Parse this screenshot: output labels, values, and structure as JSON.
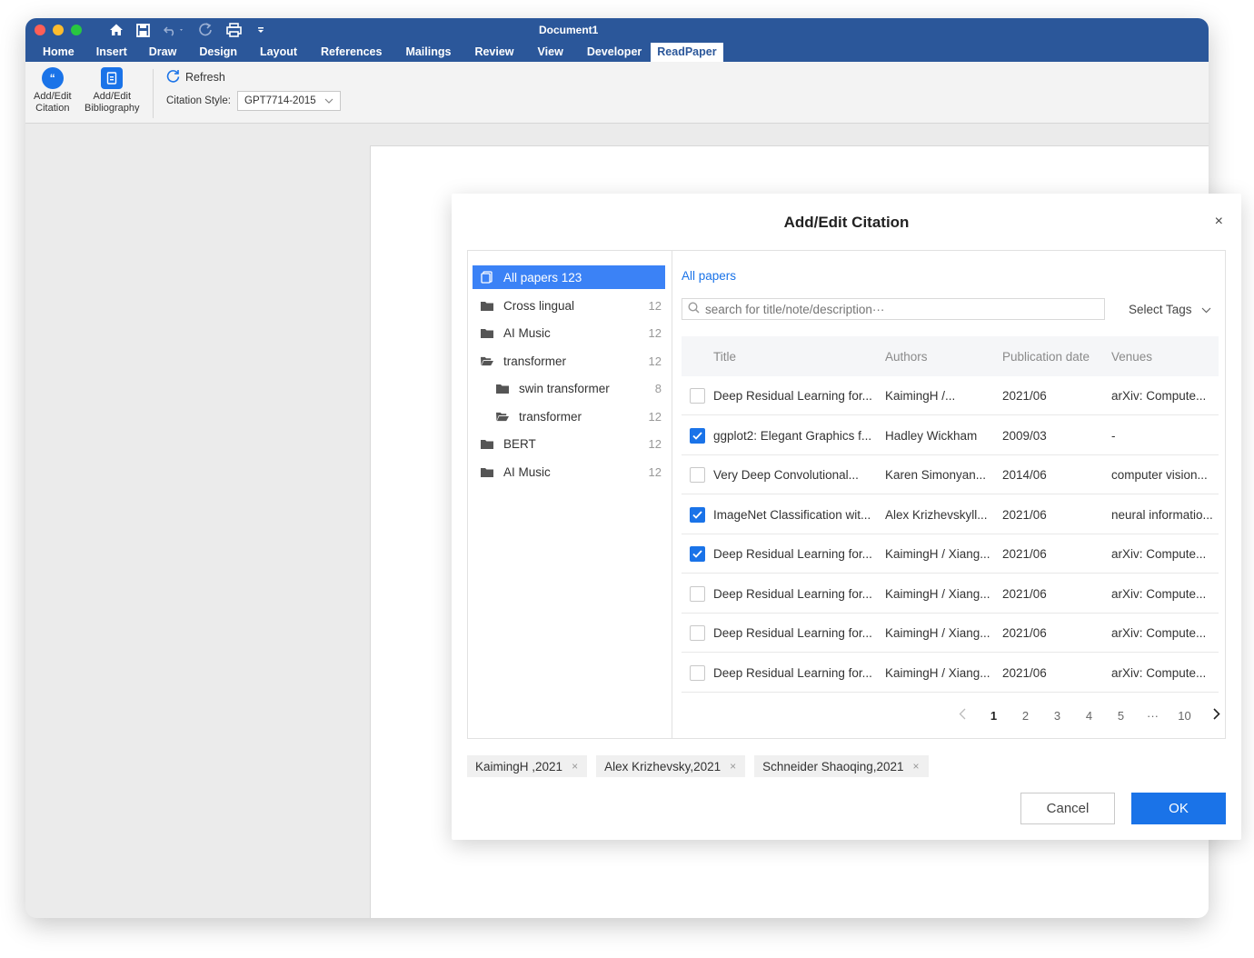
{
  "window": {
    "title": "Document1"
  },
  "tabs": [
    "Home",
    "Insert",
    "Draw",
    "Design",
    "Layout",
    "References",
    "Mailings",
    "Review",
    "View",
    "Developer",
    "ReadPaper"
  ],
  "active_tab": "ReadPaper",
  "ribbon": {
    "add_edit_citation": [
      "Add/Edit",
      "Citation"
    ],
    "add_edit_bibliography": [
      "Add/Edit",
      "Bibliography"
    ],
    "refresh": "Refresh",
    "citation_style_label": "Citation Style:",
    "citation_style_value": "GPT7714-2015"
  },
  "dialog": {
    "title": "Add/Edit Citation",
    "close": "×",
    "tree": [
      {
        "label": "All papers 123",
        "count": "",
        "icon": "document-icon",
        "active": true
      },
      {
        "label": "Cross lingual",
        "count": "12",
        "icon": "folder-icon"
      },
      {
        "label": "AI Music",
        "count": "12",
        "icon": "folder-icon"
      },
      {
        "label": "transformer",
        "count": "12",
        "icon": "folder-open-icon"
      },
      {
        "label": "swin transformer",
        "count": "8",
        "icon": "folder-icon",
        "child": true
      },
      {
        "label": "transformer",
        "count": "12",
        "icon": "folder-open-icon",
        "child": true
      },
      {
        "label": "BERT",
        "count": "12",
        "icon": "folder-icon"
      },
      {
        "label": "AI Music",
        "count": "12",
        "icon": "folder-icon"
      }
    ],
    "breadcrumb": "All papers",
    "search_placeholder": "search for title/note/description···",
    "select_tags": "Select Tags",
    "columns": [
      "Title",
      "Authors",
      "Publication date",
      "Venues"
    ],
    "rows": [
      {
        "checked": false,
        "title": "Deep Residual Learning for...",
        "authors": "KaimingH /...",
        "date": "2021/06",
        "venue": "arXiv: Compute..."
      },
      {
        "checked": true,
        "title": "ggplot2: Elegant Graphics f...",
        "authors": "Hadley Wickham",
        "date": "2009/03",
        "venue": "-"
      },
      {
        "checked": false,
        "title": "Very Deep Convolutional...",
        "authors": "Karen Simonyan...",
        "date": "2014/06",
        "venue": "computer vision..."
      },
      {
        "checked": true,
        "title": "ImageNet Classification wit...",
        "authors": "Alex Krizhevskyll...",
        "date": "2021/06",
        "venue": "neural informatio..."
      },
      {
        "checked": true,
        "title": "Deep Residual Learning for...",
        "authors": "KaimingH / Xiang...",
        "date": "2021/06",
        "venue": "arXiv: Compute..."
      },
      {
        "checked": false,
        "title": "Deep Residual Learning for...",
        "authors": "KaimingH / Xiang...",
        "date": "2021/06",
        "venue": "arXiv: Compute..."
      },
      {
        "checked": false,
        "title": "Deep Residual Learning for...",
        "authors": "KaimingH / Xiang...",
        "date": "2021/06",
        "venue": "arXiv: Compute..."
      },
      {
        "checked": false,
        "title": "Deep Residual Learning for...",
        "authors": "KaimingH / Xiang...",
        "date": "2021/06",
        "venue": "arXiv: Compute..."
      }
    ],
    "pagination": {
      "pages": [
        "1",
        "2",
        "3",
        "4",
        "5",
        "···",
        "10"
      ],
      "current": "1"
    },
    "selected": [
      "KaimingH ,2021",
      "Alex Krizhevsky,2021",
      "Schneider Shaoqing,2021"
    ],
    "cancel": "Cancel",
    "ok": "OK"
  },
  "colors": {
    "titlebar": "#2b579a",
    "accent": "#1a73e8",
    "selected_tree": "#3b82f6"
  }
}
